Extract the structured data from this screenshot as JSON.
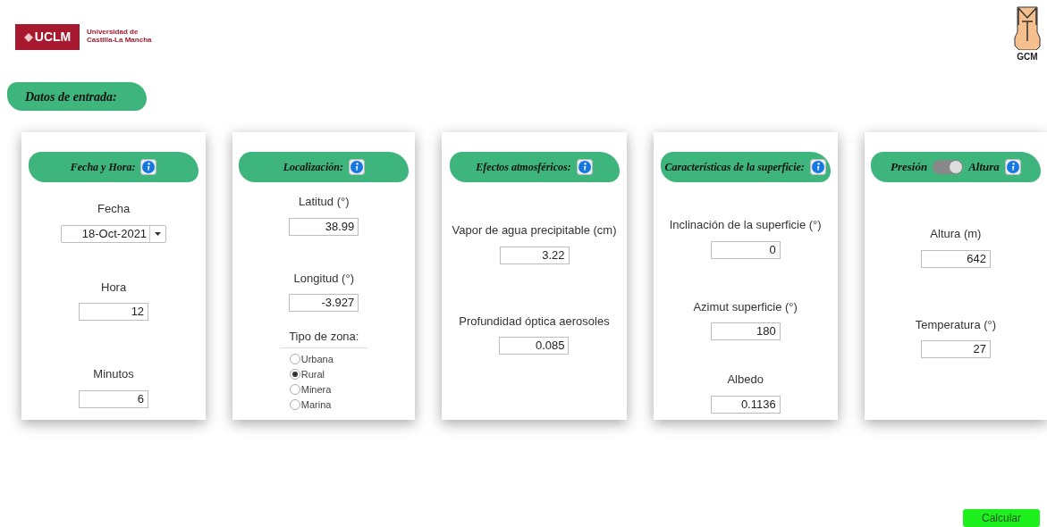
{
  "header": {
    "logo_text": "UCLM",
    "university": [
      "Universidad de",
      "Castilla-La Mancha"
    ],
    "group_logo": "GCM"
  },
  "section_title": "Datos de entrada:",
  "panels": [
    {
      "title": "Fecha y Hora:",
      "items": [
        {
          "kind": "date",
          "label": "Fecha",
          "value": "18-Oct-2021"
        },
        {
          "kind": "field",
          "label": "Hora",
          "value": "12"
        },
        {
          "kind": "field",
          "label": "Minutos",
          "value": "6"
        }
      ]
    },
    {
      "title": "Localización:",
      "items": [
        {
          "kind": "field",
          "label": "Latitud (°)",
          "value": "38.99"
        },
        {
          "kind": "field",
          "label": "Longitud (°)",
          "value": "-3.927"
        },
        {
          "kind": "radio",
          "label": "Tipo de zona:",
          "options": [
            {
              "label": "Urbana",
              "selected": false
            },
            {
              "label": "Rural",
              "selected": true
            },
            {
              "label": "Minera",
              "selected": false
            },
            {
              "label": "Marina",
              "selected": false
            }
          ]
        }
      ]
    },
    {
      "title": "Efectos atmosféricos:",
      "items": [
        {
          "kind": "field",
          "label": "Vapor de agua precipitable (cm)",
          "value": "3.22"
        },
        {
          "kind": "field",
          "label": "Profundidad óptica aerosoles",
          "value": "0.085"
        }
      ]
    },
    {
      "title": "Características de la superficie:",
      "items": [
        {
          "kind": "field",
          "label": "Inclinación de la superficie (°)",
          "value": "0"
        },
        {
          "kind": "field",
          "label": "Azimut superficie (°)",
          "value": "180"
        },
        {
          "kind": "field",
          "label": "Albedo",
          "value": "0.1136"
        }
      ]
    },
    {
      "toggle": {
        "left": "Presión",
        "right": "Altura",
        "on": true
      },
      "items": [
        {
          "kind": "field",
          "label": "Altura (m)",
          "value": "642"
        },
        {
          "kind": "field",
          "label": "Temperatura (°)",
          "value": "27"
        }
      ]
    }
  ],
  "calculate_button": "Calcular"
}
